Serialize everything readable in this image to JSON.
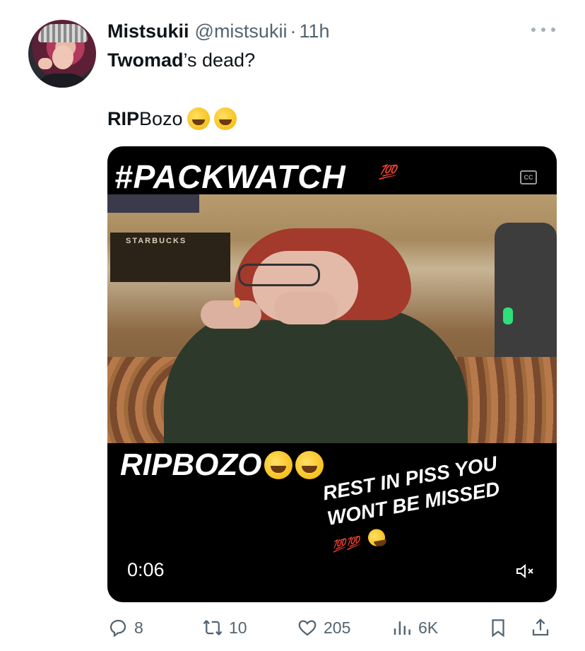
{
  "tweet": {
    "author_name": "Mistsukii",
    "author_handle": "@mistsukii",
    "separator": "·",
    "time": "11h",
    "line1_bold": "Twomad",
    "line1_rest": "’s dead?",
    "line2_bold": "RIP",
    "line2_rest": " Bozo"
  },
  "media": {
    "top_caption": "#PACKWATCH",
    "hundred_emoji": "💯",
    "cc_label": "CC",
    "store_sign": "STARBUCKS",
    "mid_caption": "RIPBOZO",
    "overlay_text_line1": "REST IN PISS YOU",
    "overlay_text_line2": "WONT BE MISSED",
    "hundred_small": "💯💯",
    "timestamp": "0:06",
    "mute_icon": "speaker-muted-icon"
  },
  "actions": {
    "replies": "8",
    "reposts": "10",
    "likes": "205",
    "views": "6K"
  },
  "colors": {
    "text": "#0f1419",
    "secondary": "#536471",
    "media_bg": "#000000"
  }
}
